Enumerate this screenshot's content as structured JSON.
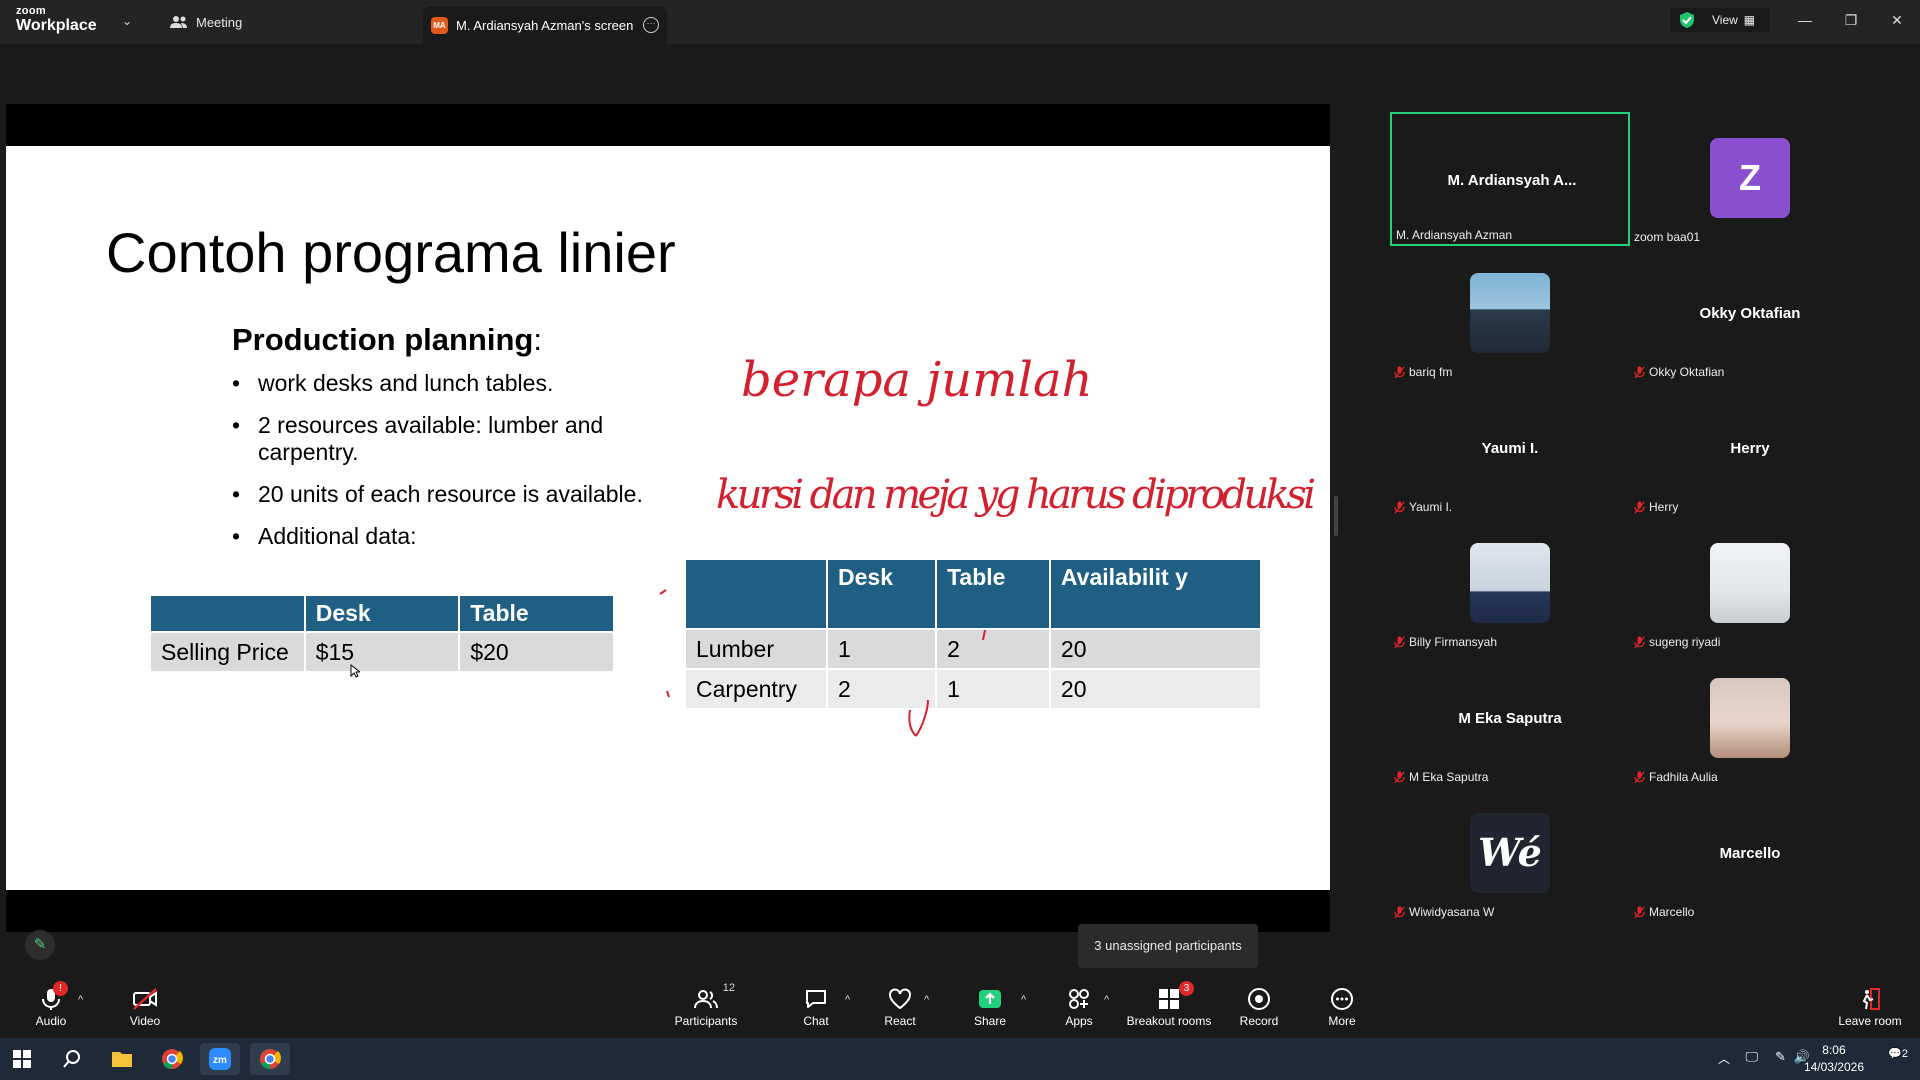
{
  "app": {
    "brand_top": "zoom",
    "brand_bottom": "Workplace",
    "tab_meeting": "Meeting",
    "tab_screen": "M. Ardiansyah Azman's screen",
    "tab_screen_badge": "MA",
    "view_label": "View"
  },
  "slide": {
    "title": "Contoh programa linier",
    "subtitle_bold": "Production planning",
    "subtitle_rest": ":",
    "bullets": [
      "work desks and lunch tables.",
      "2 resources available: lumber and carpentry.",
      "20 units of each resource is available.",
      "Additional data:"
    ],
    "price_table": {
      "headers": [
        "",
        "Desk",
        "Table"
      ],
      "rows": [
        [
          "Selling Price",
          "$15",
          "$20"
        ]
      ]
    },
    "resource_table": {
      "headers": [
        "",
        "Desk",
        "Table",
        "Availabilit y"
      ],
      "rows": [
        [
          "Lumber",
          "1",
          "2",
          "20"
        ],
        [
          "Carpentry",
          "2",
          "1",
          "20"
        ]
      ]
    },
    "handwriting": {
      "line1": "berapa jumlah",
      "line2": "kursi dan meja yg harus diproduksi"
    }
  },
  "participants": [
    {
      "name": "M. Ardiansyah A...",
      "label": "M. Ardiansyah Azman",
      "avatar": "none",
      "muted": false,
      "active": true
    },
    {
      "name": "",
      "label": "zoom baa01",
      "avatar": "Z",
      "muted": false,
      "active": false
    },
    {
      "name": "",
      "label": "bariq fm",
      "avatar": "photo",
      "muted": true,
      "active": false
    },
    {
      "name": "Okky Oktafian",
      "label": "Okky Oktafian",
      "avatar": "none",
      "muted": true,
      "active": false
    },
    {
      "name": "Yaumi I.",
      "label": "Yaumi I.",
      "avatar": "none",
      "muted": true,
      "active": false
    },
    {
      "name": "Herry",
      "label": "Herry",
      "avatar": "none",
      "muted": true,
      "active": false
    },
    {
      "name": "",
      "label": "Billy Firmansyah",
      "avatar": "photo",
      "muted": true,
      "active": false
    },
    {
      "name": "",
      "label": "sugeng riyadi",
      "avatar": "photo",
      "muted": true,
      "active": false
    },
    {
      "name": "M Eka Saputra",
      "label": "M Eka Saputra",
      "avatar": "none",
      "muted": true,
      "active": false
    },
    {
      "name": "",
      "label": "Fadhila Aulia",
      "avatar": "photo",
      "muted": true,
      "active": false
    },
    {
      "name": "",
      "label": "Wiwidyasana W",
      "avatar": "Wé",
      "muted": true,
      "active": false
    },
    {
      "name": "Marcello",
      "label": "Marcello",
      "avatar": "none",
      "muted": true,
      "active": false
    }
  ],
  "tooltip": "3 unassigned participants",
  "toolbar": {
    "audio": "Audio",
    "video": "Video",
    "participants": "Participants",
    "participants_count": "12",
    "chat": "Chat",
    "react": "React",
    "share": "Share",
    "apps": "Apps",
    "breakout": "Breakout rooms",
    "breakout_badge": "3",
    "record": "Record",
    "more": "More",
    "leave": "Leave room"
  },
  "taskbar": {
    "time": "8:06",
    "date": "14/03/2026",
    "notifications": "2"
  },
  "colors": {
    "table_header": "#1f5f84",
    "active_border": "#23d07b",
    "share_green": "#23d07b",
    "ink_red": "#d3202e"
  }
}
